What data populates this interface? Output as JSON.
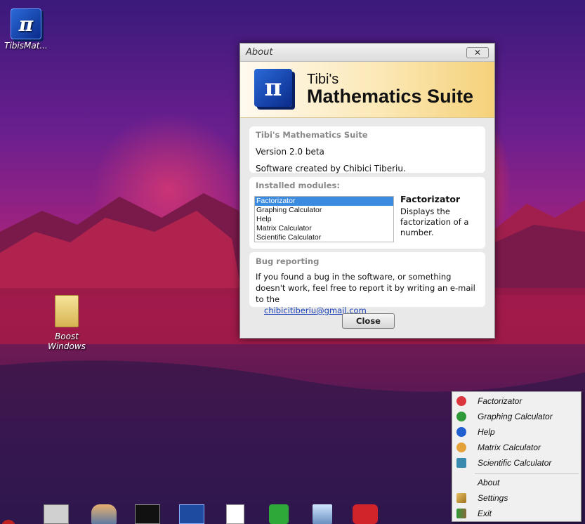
{
  "desktop": {
    "icons": [
      {
        "label": "TibisMat..."
      },
      {
        "label": "Boost Windows"
      }
    ]
  },
  "about": {
    "window_title": "About",
    "banner_subtitle": "Tibi's",
    "banner_title": "Mathematics Suite",
    "logo_glyph": "π",
    "info": {
      "header": "Tibi's Mathematics Suite",
      "version": "Version 2.0 beta",
      "credit": "Software created by Chibici Tiberiu."
    },
    "modules": {
      "header": "Installed modules:",
      "items": [
        "Factorizator",
        "Graphing Calculator",
        "Help",
        "Matrix Calculator",
        "Scientific Calculator"
      ],
      "selected_index": 0,
      "selected_name": "Factorizator",
      "selected_description": "Displays the factorization of a number."
    },
    "bug": {
      "header": "Bug reporting",
      "text": "If you found a bug in the software, or something doesn't work, feel free to report it by writing an e-mail to the",
      "email": "chibicitiberiu@gmail.com"
    },
    "close_label": "Close"
  },
  "tray_menu": {
    "modules": [
      {
        "label": "Factorizator",
        "icon": "factorizator-icon",
        "color": "#d9363e"
      },
      {
        "label": "Graphing Calculator",
        "icon": "graphing-calculator-icon",
        "color": "#2f9a3a"
      },
      {
        "label": "Help",
        "icon": "help-icon",
        "color": "#1f5fd0"
      },
      {
        "label": "Matrix Calculator",
        "icon": "matrix-calculator-icon",
        "color": "#e6a23a"
      },
      {
        "label": "Scientific Calculator",
        "icon": "scientific-calculator-icon",
        "color": "#3a8ab0"
      }
    ],
    "about_label": "About",
    "settings_label": "Settings",
    "exit_label": "Exit"
  },
  "taskbar": {
    "apps": [
      {
        "icon": "computer-icon"
      },
      {
        "icon": "users-icon"
      },
      {
        "icon": "command-prompt-icon"
      },
      {
        "icon": "powershell-icon"
      },
      {
        "icon": "document-icon"
      },
      {
        "icon": "download-icon"
      },
      {
        "icon": "recycle-bin-icon"
      },
      {
        "icon": "vivaldi-icon"
      }
    ]
  }
}
